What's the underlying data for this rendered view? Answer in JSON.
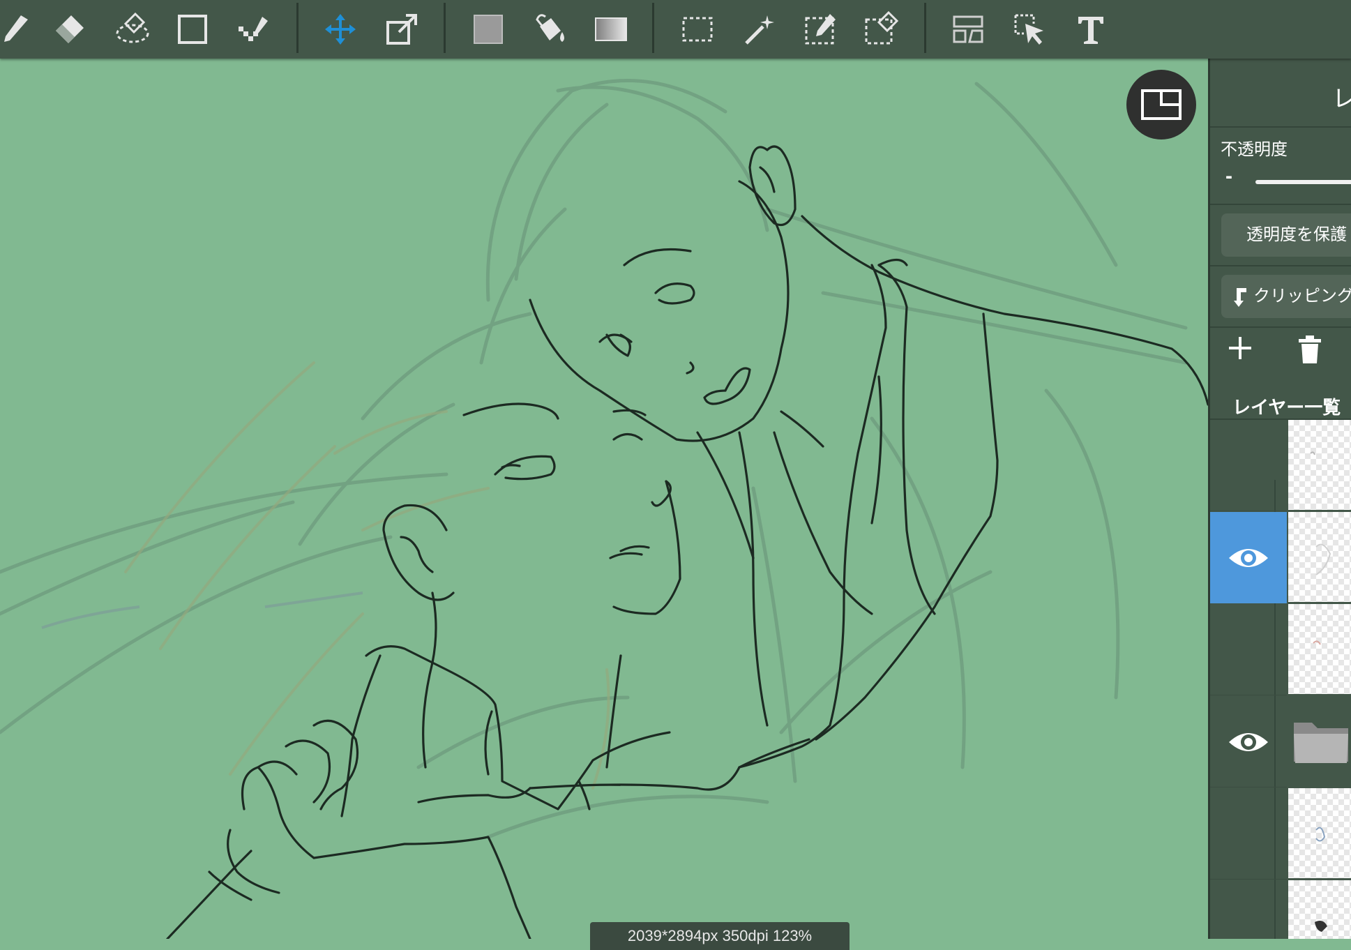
{
  "toolbar": {
    "tools": [
      {
        "icon": "brush-icon",
        "active": false
      },
      {
        "icon": "eraser-icon",
        "active": false
      },
      {
        "icon": "lasso-eraser-icon",
        "active": false
      },
      {
        "icon": "shape-icon",
        "active": false
      },
      {
        "icon": "dot-pen-icon",
        "active": false
      },
      {
        "icon": "move-icon",
        "active": true
      },
      {
        "icon": "transform-icon",
        "active": false
      },
      {
        "icon": "fill-color-icon",
        "active": false
      },
      {
        "icon": "bucket-icon",
        "active": false
      },
      {
        "icon": "gradient-icon",
        "active": false
      },
      {
        "icon": "select-rect-icon",
        "active": false
      },
      {
        "icon": "magic-wand-icon",
        "active": false
      },
      {
        "icon": "select-pen-icon",
        "active": false
      },
      {
        "icon": "select-eraser-icon",
        "active": false
      },
      {
        "icon": "frame-divide-icon",
        "active": false
      },
      {
        "icon": "select-cursor-icon",
        "active": false
      },
      {
        "icon": "text-icon",
        "active": false
      }
    ],
    "accent_color": "#1f8fd6"
  },
  "canvas": {
    "background_color": "#81b991",
    "status_text": "2039*2894px 350dpi 123%"
  },
  "navigator": {
    "icon": "navigator-icon"
  },
  "layer_panel": {
    "title": "レ",
    "opacity_label": "不透明度",
    "opacity_minus": "-",
    "protect_alpha_label": "透明度を保護",
    "clipping_label": "クリッピング",
    "add_icon": "plus-icon",
    "delete_icon": "trash-icon",
    "list_title": "レイヤー一覧",
    "layers": [
      {
        "visible": false,
        "selected": false,
        "kind": "raster"
      },
      {
        "visible": true,
        "selected": true,
        "kind": "raster"
      },
      {
        "visible": false,
        "selected": false,
        "kind": "raster"
      },
      {
        "visible": true,
        "selected": false,
        "kind": "folder"
      },
      {
        "visible": false,
        "selected": false,
        "kind": "raster"
      },
      {
        "visible": false,
        "selected": false,
        "kind": "raster"
      }
    ],
    "selection_color": "#4e98dc"
  }
}
